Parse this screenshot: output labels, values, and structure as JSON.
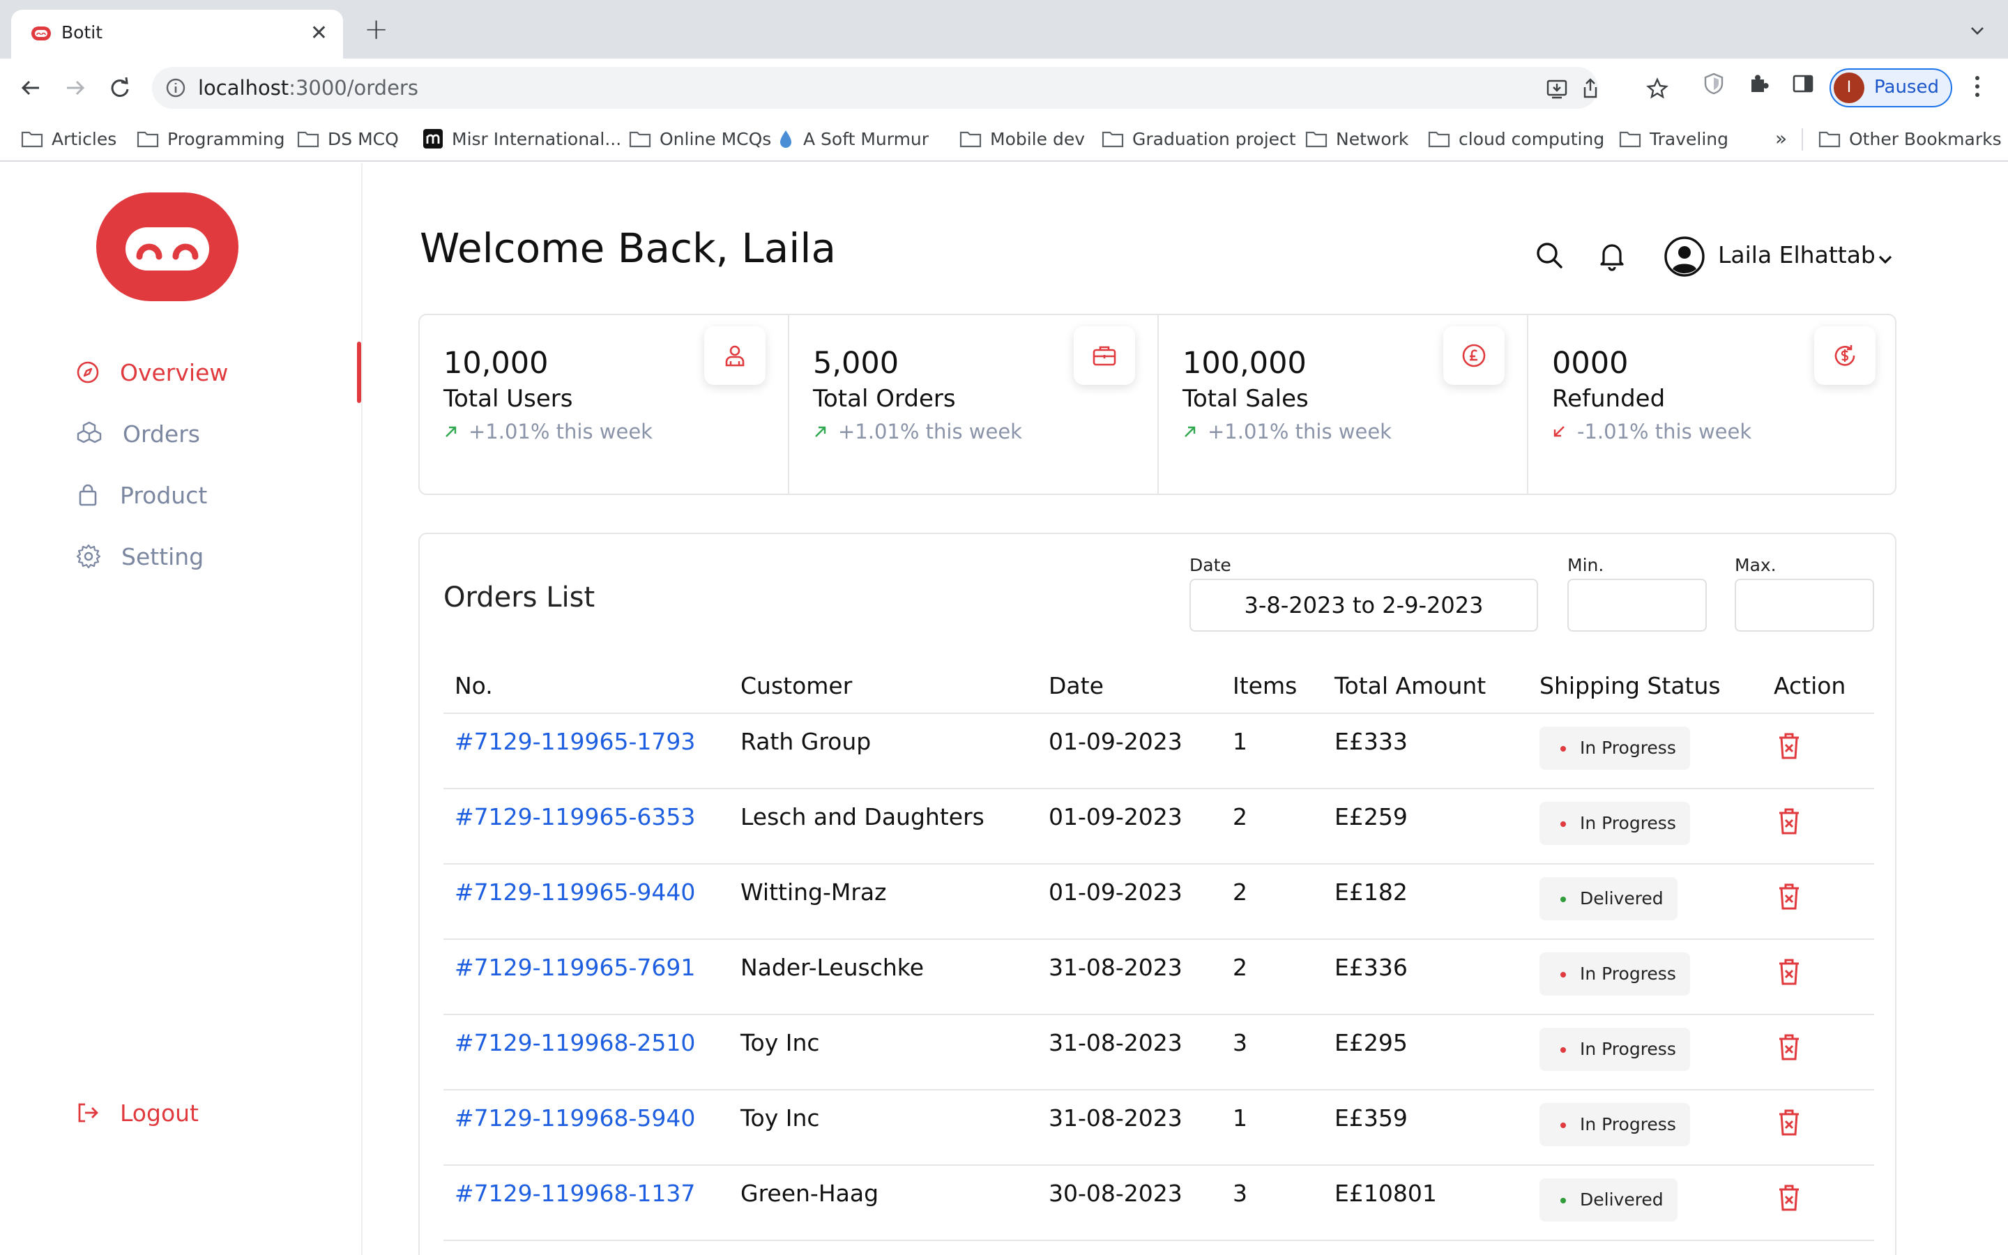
{
  "browser": {
    "tab_title": "Botit",
    "url_host": "localhost",
    "url_rest": ":3000/orders",
    "profile_initial": "I",
    "profile_label": "Paused",
    "bookmarks": [
      "Articles",
      "Programming",
      "DS MCQ",
      "Misr International...",
      "Online MCQs",
      "A Soft Murmur",
      "Mobile dev",
      "Graduation project",
      "Network",
      "cloud computing",
      "Traveling"
    ],
    "bookmarks_more": "»",
    "other_bookmarks": "Other Bookmarks"
  },
  "colors": {
    "accent": "#e03a3e",
    "link": "#1d5fe0",
    "muted": "#7b86a0",
    "positive": "#2fa84f",
    "in_progress": "#e03a3e",
    "delivered": "#2f9b3a"
  },
  "sidebar": {
    "items": [
      {
        "label": "Overview",
        "icon": "compass-icon"
      },
      {
        "label": "Orders",
        "icon": "boxes-icon"
      },
      {
        "label": "Product",
        "icon": "bag-icon"
      },
      {
        "label": "Setting",
        "icon": "gear-icon"
      }
    ],
    "logout": "Logout"
  },
  "header": {
    "welcome": "Welcome Back, Laila",
    "user_name": "Laila Elhattab"
  },
  "stats": [
    {
      "value": "10,000",
      "label": "Total Users",
      "trend": "+1.01% this week",
      "icon": "users-icon"
    },
    {
      "value": "5,000",
      "label": "Total Orders",
      "trend": "+1.01% this week",
      "icon": "briefcase-icon"
    },
    {
      "value": "100,000",
      "label": "Total Sales",
      "trend": "+1.01% this week",
      "icon": "pound-icon"
    },
    {
      "value": "0000",
      "label": "Refunded",
      "trend": "-1.01% this week",
      "icon": "refund-icon"
    }
  ],
  "orders": {
    "title": "Orders List",
    "date_label": "Date",
    "date_value": "3-8-2023 to 2-9-2023",
    "min_label": "Min.",
    "min_value": "",
    "max_label": "Max.",
    "max_value": "",
    "columns": [
      "No.",
      "Customer",
      "Date",
      "Items",
      "Total Amount",
      "Shipping Status",
      "Action"
    ],
    "rows": [
      {
        "no": "#7129-119965-1793",
        "customer": "Rath Group",
        "date": "01-09-2023",
        "items": "1",
        "total": "E£333",
        "status": "In Progress"
      },
      {
        "no": "#7129-119965-6353",
        "customer": "Lesch and Daughters",
        "date": "01-09-2023",
        "items": "2",
        "total": "E£259",
        "status": "In Progress"
      },
      {
        "no": "#7129-119965-9440",
        "customer": "Witting-Mraz",
        "date": "01-09-2023",
        "items": "2",
        "total": "E£182",
        "status": "Delivered"
      },
      {
        "no": "#7129-119965-7691",
        "customer": "Nader-Leuschke",
        "date": "31-08-2023",
        "items": "2",
        "total": "E£336",
        "status": "In Progress"
      },
      {
        "no": "#7129-119968-2510",
        "customer": "Toy Inc",
        "date": "31-08-2023",
        "items": "3",
        "total": "E£295",
        "status": "In Progress"
      },
      {
        "no": "#7129-119968-5940",
        "customer": "Toy Inc",
        "date": "31-08-2023",
        "items": "1",
        "total": "E£359",
        "status": "In Progress"
      },
      {
        "no": "#7129-119968-1137",
        "customer": "Green-Haag",
        "date": "30-08-2023",
        "items": "3",
        "total": "E£10801",
        "status": "Delivered"
      }
    ]
  }
}
